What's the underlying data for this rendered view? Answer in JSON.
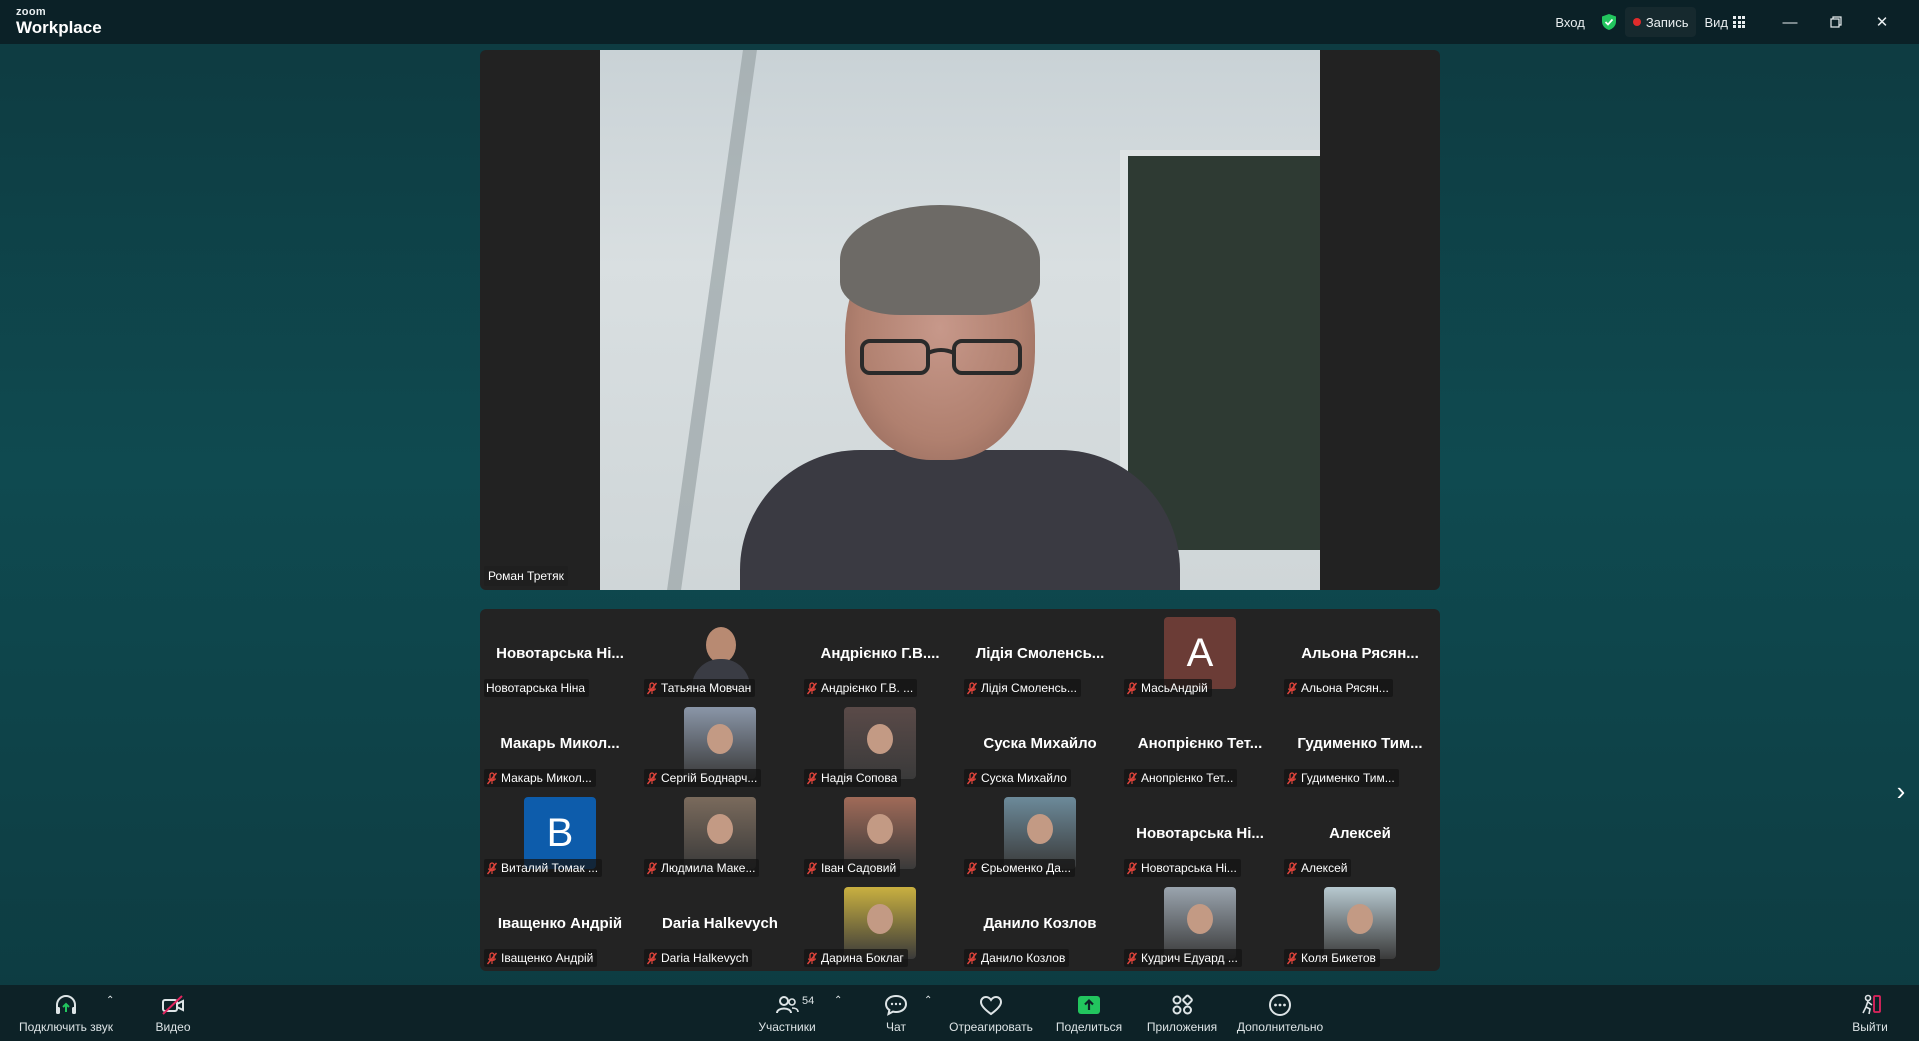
{
  "app": {
    "logo_small": "zoom",
    "logo_large": "Workplace"
  },
  "topbar": {
    "signin": "Вход",
    "record": "Запись",
    "view": "Вид"
  },
  "speaker": {
    "name": "Роман Третяк"
  },
  "gallery": {
    "tiles": [
      {
        "big": "Новотарська Ні...",
        "label": "Новотарська Ніна",
        "muted": false,
        "kind": "name"
      },
      {
        "big": "",
        "label": "Татьяна Мовчан",
        "muted": true,
        "kind": "video"
      },
      {
        "big": "Андрієнко Г.В....",
        "label": "Андрієнко Г.В. ...",
        "muted": true,
        "kind": "name"
      },
      {
        "big": "Лідія Смоленсь...",
        "label": "Лідія Смоленсь...",
        "muted": true,
        "kind": "name"
      },
      {
        "big": "A",
        "label": "МасьАндрій",
        "muted": true,
        "kind": "letter",
        "color": "#6b3c36"
      },
      {
        "big": "Альона Рясян...",
        "label": "Альона Рясян...",
        "muted": true,
        "kind": "name"
      },
      {
        "big": "Макарь Микол...",
        "label": "Макарь Микол...",
        "muted": true,
        "kind": "name"
      },
      {
        "big": "",
        "label": "Сергій Боднарч...",
        "muted": true,
        "kind": "photo",
        "color": "#8a96a8"
      },
      {
        "big": "",
        "label": "Надія Сопова",
        "muted": true,
        "kind": "photo",
        "color": "#5a4a48"
      },
      {
        "big": "Суска Михайло",
        "label": "Суска Михайло",
        "muted": true,
        "kind": "name"
      },
      {
        "big": "Анопрієнко Тет...",
        "label": "Анопрієнко Тет...",
        "muted": true,
        "kind": "name"
      },
      {
        "big": "Гудименко Тим...",
        "label": "Гудименко Тим...",
        "muted": true,
        "kind": "name"
      },
      {
        "big": "B",
        "label": "Виталий Томак ...",
        "muted": true,
        "kind": "letter",
        "color": "#0d5cab"
      },
      {
        "big": "",
        "label": "Людмила Маке...",
        "muted": true,
        "kind": "photo",
        "color": "#7a6a5c"
      },
      {
        "big": "",
        "label": "Іван Садовий",
        "muted": true,
        "kind": "photo",
        "color": "#a06a58"
      },
      {
        "big": "",
        "label": "Єрьоменко Да...",
        "muted": true,
        "kind": "photo",
        "color": "#6c8a9a"
      },
      {
        "big": "Новотарська Ні...",
        "label": "Новотарська Ні...",
        "muted": true,
        "kind": "name"
      },
      {
        "big": "Алексей",
        "label": "Алексей",
        "muted": true,
        "kind": "name"
      },
      {
        "big": "Іващенко Андрій",
        "label": "Іващенко Андрій",
        "muted": true,
        "kind": "name"
      },
      {
        "big": "Daria Halkevych",
        "label": "Daria Halkevych",
        "muted": true,
        "kind": "name"
      },
      {
        "big": "",
        "label": "Дарина Боклаг",
        "muted": true,
        "kind": "photo",
        "color": "#c9b040"
      },
      {
        "big": "Данило Козлов",
        "label": "Данило Козлов",
        "muted": true,
        "kind": "name"
      },
      {
        "big": "",
        "label": "Кудрич Едуард ...",
        "muted": true,
        "kind": "photo",
        "color": "#9aa4ae"
      },
      {
        "big": "",
        "label": "Коля Бикетов",
        "muted": true,
        "kind": "photo",
        "color": "#b7c9d0"
      }
    ]
  },
  "toolbar": {
    "audio": "Подключить звук",
    "video": "Видео",
    "participants": "Участники",
    "participants_count": "54",
    "chat": "Чат",
    "react": "Отреагировать",
    "share": "Поделиться",
    "apps": "Приложения",
    "more": "Дополнительно",
    "leave": "Выйти"
  },
  "colors": {
    "accent_green": "#22c55e",
    "rec_red": "#e02b2b",
    "leave_red": "#e0245e"
  }
}
